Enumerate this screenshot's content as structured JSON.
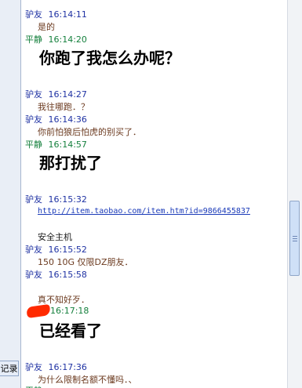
{
  "sidebar": {
    "history_tab_label": "记录"
  },
  "messages": [
    {
      "sender": "驴友",
      "time": "16:14:11",
      "text": "是的",
      "big": false
    },
    {
      "sender": "平静",
      "time": "16:14:20",
      "text": "你跑了我怎么办呢？",
      "big": true
    },
    {
      "sender": "驴友",
      "time": "16:14:27",
      "text": "我往哪跑．？"
    },
    {
      "sender": "驴友",
      "time": "16:14:36",
      "text": "你前怕狼后怕虎的别买了．"
    },
    {
      "sender": "平静",
      "time": "16:14:57",
      "text": "那打扰了",
      "big": true
    },
    {
      "sender": "驴友",
      "time": "16:15:32",
      "link": "http://item.taobao.com/item.htm?id=9866455837",
      "text": "安全主机"
    },
    {
      "sender": "驴友",
      "time": "16:15:52",
      "text": "150 10G 仅限DZ朋友．"
    },
    {
      "sender": "驴友",
      "time": "16:15:58",
      "text": "真不知好歹．"
    },
    {
      "sender": "",
      "time": "16:17:18",
      "text": "已经看了",
      "big": true
    },
    {
      "sender": "驴友",
      "time": "16:17:36",
      "text": "为什么限制名额不懂吗．、"
    },
    {
      "sender": "平静",
      "time": "",
      "text": ""
    }
  ],
  "colors": {
    "friend_header": "#1f32a3",
    "self_header": "#15803d",
    "redaction": "#ff2a00"
  }
}
